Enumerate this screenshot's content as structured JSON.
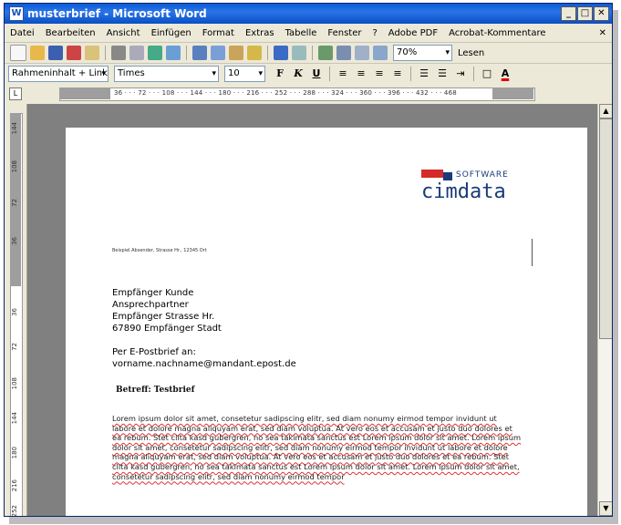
{
  "window": {
    "title": "musterbrief - Microsoft Word",
    "app_icon_glyph": "W",
    "controls": {
      "minimize": "_",
      "maximize": "□",
      "close": "✕"
    }
  },
  "menubar": {
    "items": [
      "Datei",
      "Bearbeiten",
      "Ansicht",
      "Einfügen",
      "Format",
      "Extras",
      "Tabelle",
      "Fenster",
      "?",
      "Adobe PDF",
      "Acrobat-Kommentare"
    ],
    "close_doc": "✕"
  },
  "toolbar": {
    "zoom": "70%",
    "read_button": "Lesen",
    "icons": [
      "new-doc-icon",
      "open-icon",
      "save-icon",
      "permission-icon",
      "email-icon",
      "print-icon",
      "print-preview-icon",
      "spellcheck-icon",
      "research-icon",
      "cut-icon",
      "copy-icon",
      "paste-icon",
      "format-painter-icon",
      "undo-icon",
      "redo-icon",
      "hyperlink-icon",
      "tables-icon",
      "insert-table-icon",
      "columns-icon"
    ]
  },
  "format_toolbar": {
    "style": "Rahmeninhalt + Link",
    "font": "Times",
    "size": "10",
    "bold": "F",
    "italic": "K",
    "underline": "U",
    "font_color_glyph": "A"
  },
  "ruler": {
    "tab_selector": "L",
    "h_ticks": "36 · · · 72 · · · 108 · · · 144 · · · 180 · · · 216 · · · 252 · · · 288 · · · 324 · · · 360 · · · 396 · · · 432 · · · 468",
    "v_ticks": [
      "144",
      "108",
      "72",
      "36",
      "36",
      "72",
      "108",
      "144",
      "180",
      "216",
      "252"
    ]
  },
  "document": {
    "logo": {
      "software": "SOFTWARE",
      "name": "cimdata"
    },
    "sender_line": "Beispiel Absender, Strasse Hr., 12345 Ort",
    "recipient": [
      "Empfänger Kunde",
      "Ansprechpartner",
      "Empfänger Strasse Hr.",
      "67890  Empfänger Stadt"
    ],
    "epost_label": "Per E-Postbrief an:",
    "epost_address": "vorname.nachname@mandant.epost.de",
    "subject": "Betreff: Testbrief",
    "body": "Lorem ipsum dolor sit amet, consetetur sadipscing elitr, sed diam nonumy eirmod tempor invidunt ut labore et dolore magna aliquyam erat, sed diam voluptua. At vero eos et accusam et justo duo dolores et ea rebum. Stet clita kasd gubergren, no sea takimata sanctus est Lorem ipsum dolor sit amet. Lorem ipsum dolor sit amet, consetetur sadipscing elitr, sed diam nonumy eirmod tempor invidunt ut labore et dolore magna aliquyam erat, sed diam voluptua. At vero eos et accusam et justo duo dolores et ea rebum. Stet clita kasd gubergren, no sea takimata sanctus est Lorem ipsum dolor sit amet. Lorem ipsum dolor sit amet, consetetur sadipscing elitr, sed diam nonumy eirmod tempor"
  },
  "colors": {
    "titlebar": "#0a5cd8",
    "logo_red": "#d42a2a",
    "logo_blue": "#1a3b7a"
  }
}
